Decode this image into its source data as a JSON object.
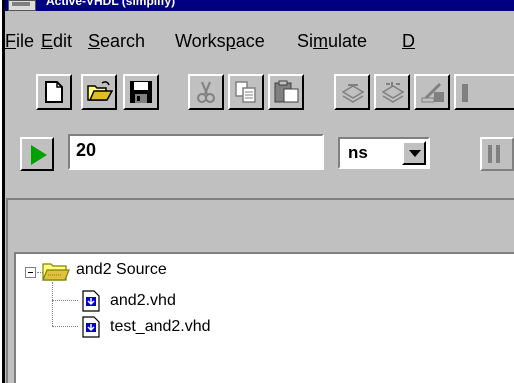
{
  "window": {
    "title": "Active-VHDL (simplify)"
  },
  "menu": [
    {
      "label": "File",
      "mnemonic": "F",
      "rest": "ile"
    },
    {
      "label": "Edit",
      "mnemonic": "E",
      "rest": "dit"
    },
    {
      "label": "Search",
      "mnemonic": "S",
      "rest": "earch"
    },
    {
      "label": "Workspace",
      "pre": "Works",
      "mnemonic": "p",
      "rest": "ace"
    },
    {
      "label": "Simulate",
      "pre": "Si",
      "mnemonic": "m",
      "rest": "ulate"
    },
    {
      "label": "D",
      "mnemonic": "D",
      "rest": ""
    }
  ],
  "toolbar": {
    "buttons": [
      {
        "icon": "new-file-icon"
      },
      {
        "icon": "open-folder-icon"
      },
      {
        "icon": "save-icon"
      },
      {
        "icon": "cut-icon"
      },
      {
        "icon": "copy-icon"
      },
      {
        "icon": "paste-icon"
      },
      {
        "icon": "compile-icon"
      },
      {
        "icon": "compile-all-icon"
      },
      {
        "icon": "build-icon"
      }
    ]
  },
  "simulation": {
    "run_icon": "run-play-icon",
    "time_value": "20",
    "unit": "ns",
    "pause_icon": "pause-icon"
  },
  "tree": {
    "root": {
      "label": "and2 Source",
      "icon": "folder-icon"
    },
    "files": [
      {
        "label": "and2.vhd",
        "icon": "vhdl-file-icon"
      },
      {
        "label": "test_and2.vhd",
        "icon": "vhdl-file-icon"
      }
    ]
  },
  "colors": {
    "face": "#c0c0c0",
    "title": "#000080",
    "run_green": "#00a000"
  }
}
